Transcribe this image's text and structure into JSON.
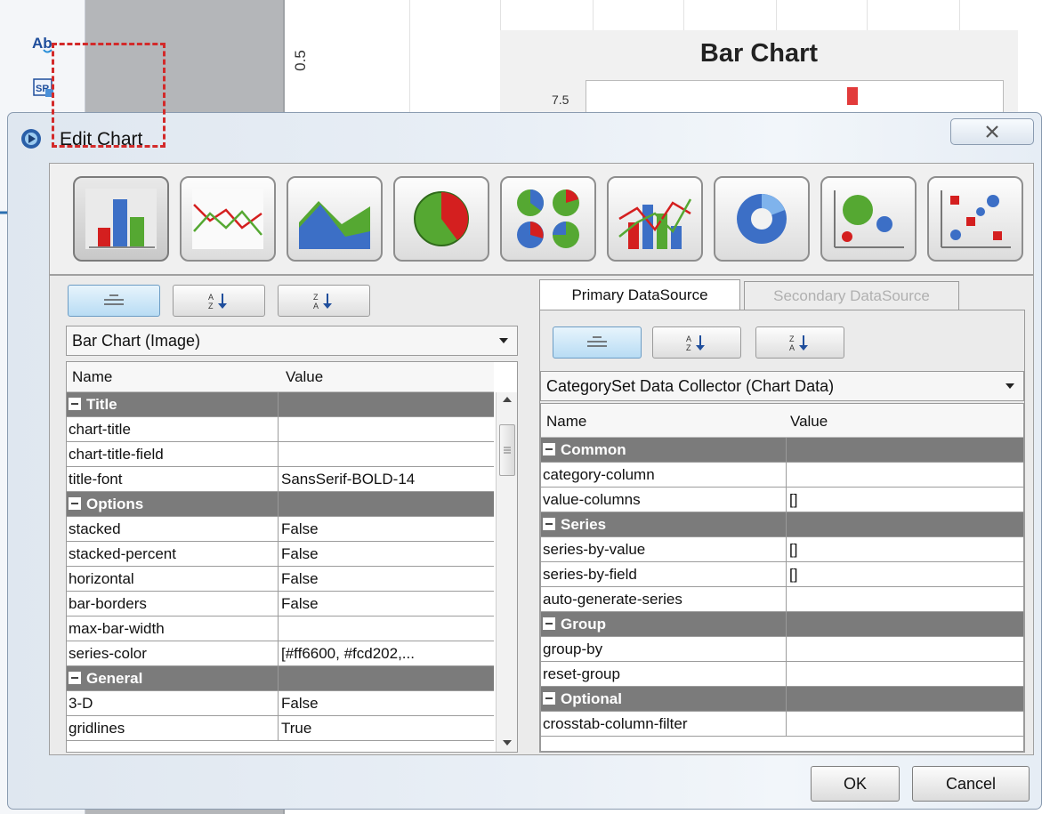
{
  "background": {
    "axis_tick_label": "0.5",
    "chart_title": "Bar Chart",
    "y_tick_label": "7.5"
  },
  "dialog": {
    "title": "Edit Chart",
    "chart_types": [
      {
        "id": "bar",
        "selected": true
      },
      {
        "id": "line",
        "selected": false
      },
      {
        "id": "area",
        "selected": false
      },
      {
        "id": "pie",
        "selected": false
      },
      {
        "id": "multi-pie",
        "selected": false
      },
      {
        "id": "bar-line",
        "selected": false
      },
      {
        "id": "ring",
        "selected": false
      },
      {
        "id": "bubble",
        "selected": false
      },
      {
        "id": "scatter",
        "selected": false
      }
    ]
  },
  "left_panel": {
    "selector": "Bar Chart (Image)",
    "col_name": "Name",
    "col_value": "Value",
    "rows": [
      {
        "type": "group",
        "name": "Title"
      },
      {
        "type": "prop",
        "name": "chart-title",
        "value": ""
      },
      {
        "type": "prop",
        "name": "chart-title-field",
        "value": ""
      },
      {
        "type": "prop",
        "name": "title-font",
        "value": "SansSerif-BOLD-14"
      },
      {
        "type": "group",
        "name": "Options"
      },
      {
        "type": "prop",
        "name": "stacked",
        "value": "False"
      },
      {
        "type": "prop",
        "name": "stacked-percent",
        "value": "False"
      },
      {
        "type": "prop",
        "name": "horizontal",
        "value": "False"
      },
      {
        "type": "prop",
        "name": "bar-borders",
        "value": "False"
      },
      {
        "type": "prop",
        "name": "max-bar-width",
        "value": ""
      },
      {
        "type": "prop",
        "name": "series-color",
        "value": "[#ff6600, #fcd202,..."
      },
      {
        "type": "group",
        "name": "General"
      },
      {
        "type": "prop",
        "name": "3-D",
        "value": "False"
      },
      {
        "type": "prop",
        "name": "gridlines",
        "value": "True"
      }
    ]
  },
  "right_panel": {
    "tab_primary": "Primary DataSource",
    "tab_secondary": "Secondary DataSource",
    "selector": "CategorySet Data Collector (Chart Data)",
    "col_name": "Name",
    "col_value": "Value",
    "rows": [
      {
        "type": "group",
        "name": "Common"
      },
      {
        "type": "prop",
        "name": "category-column",
        "value": ""
      },
      {
        "type": "prop",
        "name": "value-columns",
        "value": "[]"
      },
      {
        "type": "group",
        "name": "Series"
      },
      {
        "type": "prop",
        "name": "series-by-value",
        "value": "[]"
      },
      {
        "type": "prop",
        "name": "series-by-field",
        "value": "[]"
      },
      {
        "type": "prop",
        "name": "auto-generate-series",
        "value": ""
      },
      {
        "type": "group",
        "name": "Group"
      },
      {
        "type": "prop",
        "name": "group-by",
        "value": ""
      },
      {
        "type": "prop",
        "name": "reset-group",
        "value": ""
      },
      {
        "type": "group",
        "name": "Optional"
      },
      {
        "type": "prop",
        "name": "crosstab-column-filter",
        "value": ""
      }
    ]
  },
  "buttons": {
    "ok": "OK",
    "cancel": "Cancel"
  }
}
